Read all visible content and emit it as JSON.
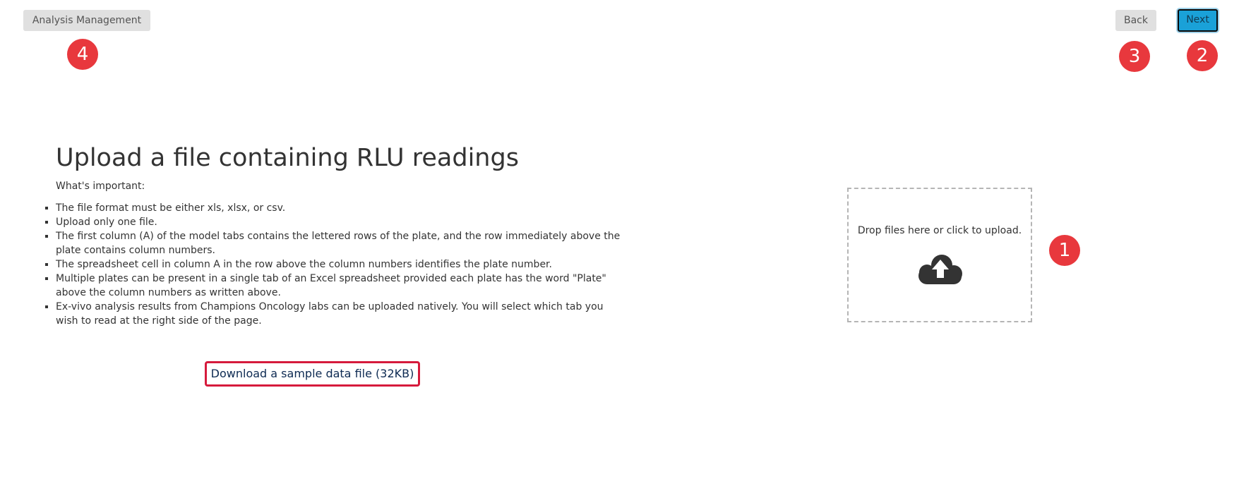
{
  "header": {
    "analysis_management_label": "Analysis Management",
    "back_label": "Back",
    "next_label": "Next"
  },
  "badges": {
    "one": "1",
    "two": "2",
    "three": "3",
    "four": "4"
  },
  "main": {
    "title": "Upload a file containing RLU readings",
    "important_label": "What's important:",
    "requirements": [
      "The file format must be either xls, xlsx, or csv.",
      "Upload only one file.",
      "The first column (A) of the model tabs contains the lettered rows of the plate, and the row immediately above the plate contains column numbers.",
      "The spreadsheet cell in column A in the row above the column numbers identifies the plate number.",
      "Multiple plates can be present in a single tab of an Excel spreadsheet provided each plate has the word \"Plate\" above the column numbers as written above.",
      "Ex-vivo analysis results from Champions Oncology labs can be uploaded natively. You will select which tab you wish to read at the right side of the page."
    ],
    "download_label": "Download a sample data file (32KB)"
  },
  "dropzone": {
    "text": "Drop files here or click to upload.",
    "icon": "cloud-upload-icon"
  },
  "colors": {
    "badge": "#e8383d",
    "next_button": "#1aa1d8",
    "download_border": "#d61a3c",
    "download_text": "#0d2a52",
    "gray_button": "#e0e0e0"
  }
}
